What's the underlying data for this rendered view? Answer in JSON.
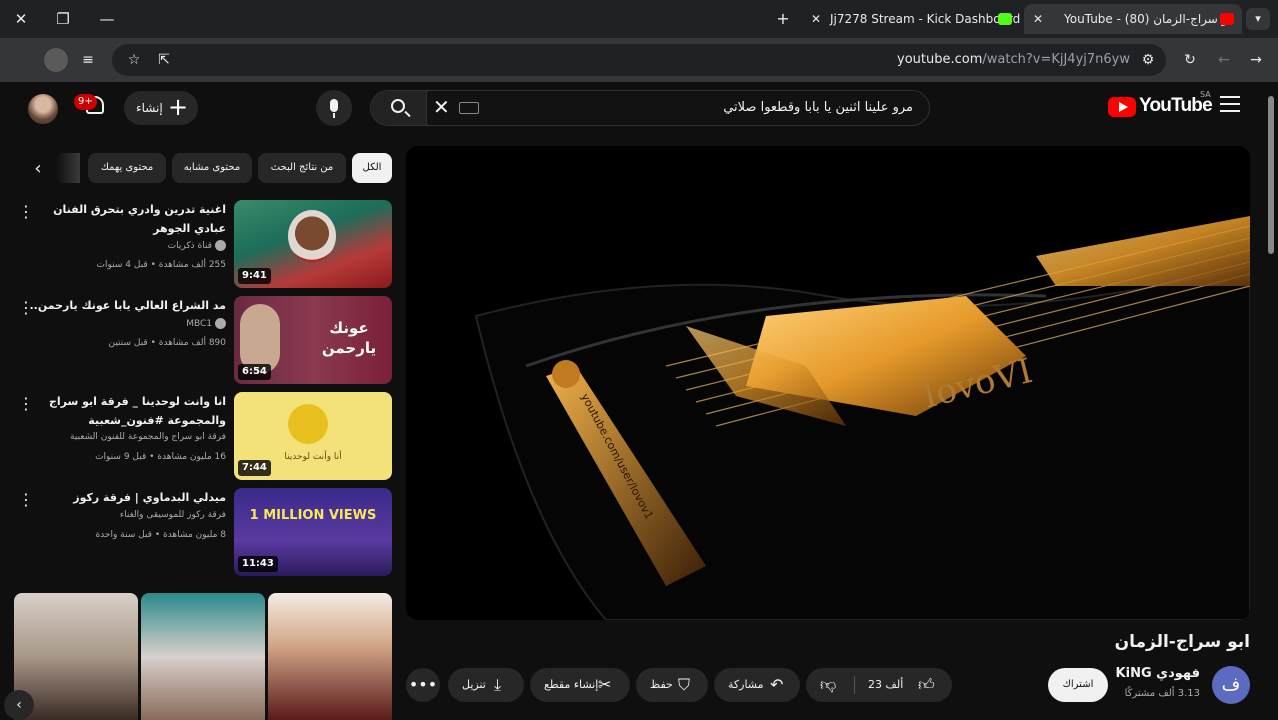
{
  "browser": {
    "tabs": [
      {
        "title": "YouTube - ابو سراج-الزمان (80)",
        "active": true
      },
      {
        "title": "Jj7278 Stream - Kick Dashboard",
        "active": false
      }
    ],
    "url_host": "youtube.com",
    "url_path": "/watch?v=KjJ4yj7n6yw",
    "colors": {
      "chrome": "#202124",
      "toolbar": "#35363a",
      "kick": "#53fc18",
      "yt_red": "#ff0000"
    }
  },
  "header": {
    "logo_text": "YouTube",
    "country_code": "SA",
    "search_value": "مرو علينا اثنين يا بابا وقطعوا صلاتي",
    "create_label": "إنشاء",
    "notification_count": "9+"
  },
  "player": {
    "watermark_text": "IovoVI",
    "neck_text": "youtube.com/user/Iovov1"
  },
  "video": {
    "title": "ابو سراج-الزمان",
    "channel_initial": "ف",
    "channel_name": "فهودي KiNG",
    "subscribers": "3.13 ألف مشتركًا",
    "subscribe_label": "اشتراك",
    "likes": "23 ألف",
    "share_label": "مشاركة",
    "save_label": "حفظ",
    "clip_label": "إنشاء مقطع",
    "download_label": "تنزيل"
  },
  "chips": [
    {
      "label": "الكل",
      "active": true
    },
    {
      "label": "من نتائج البحث",
      "active": false
    },
    {
      "label": "محتوى مشابه",
      "active": false
    },
    {
      "label": "محتوى يهمك",
      "active": false
    }
  ],
  "recommendations": [
    {
      "title": "اغنية تدرين وادري بتحرق الفنان عبادي الجوهر",
      "channel": "قناة ذكريات",
      "verified": true,
      "meta": "255 ألف مشاهدة • قبل 4 سنوات",
      "duration": "9:41"
    },
    {
      "title": "مد الشراع العالي يابا عونك يارحمن..",
      "channel": "MBC1",
      "verified": true,
      "meta": "890 ألف مشاهدة • قبل سنتين",
      "duration": "6:54",
      "thumb_text": "عونك يارحمن"
    },
    {
      "title": "انا وانت لوحدينا _ فرقة ابو سراج والمجموعة #فنون_شعبية",
      "channel": "فرقة ابو سراج والمجموعة للفنون الشعبية",
      "verified": false,
      "meta": "16 مليون مشاهدة • قبل 9 سنوات",
      "duration": "7:44",
      "thumb_text": "أنا وأنت لوحدينا"
    },
    {
      "title": "ميدلي البدماوي | فرقة ركوز",
      "channel": "فرقة ركوز للموسيقى والغناء",
      "verified": false,
      "meta": "8 مليون مشاهدة • قبل سنة واحدة",
      "duration": "11:43",
      "thumb_text": "1 MILLION VIEWS"
    }
  ]
}
